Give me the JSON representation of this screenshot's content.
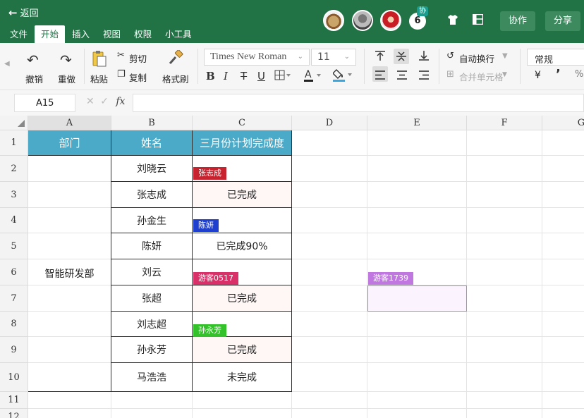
{
  "header": {
    "back_label": "返回",
    "collab_badge": "协",
    "user_count": "6",
    "collab_button": "协作",
    "share_button": "分享"
  },
  "menu": {
    "items": [
      "文件",
      "开始",
      "插入",
      "视图",
      "权限",
      "小工具"
    ],
    "active": "开始"
  },
  "ribbon": {
    "undo": "撤销",
    "redo": "重做",
    "paste": "粘贴",
    "cut": "剪切",
    "copy": "复制",
    "format_painter": "格式刷",
    "font_name": "Times New Roman",
    "font_size": "11",
    "wrap_text": "自动换行",
    "merge_cells": "合并单元格",
    "number_format": "常规",
    "currency_symbol": "¥"
  },
  "formula_bar": {
    "cell_ref": "A15",
    "fx": "fx",
    "value": ""
  },
  "columns": [
    "A",
    "B",
    "C",
    "D",
    "E",
    "F",
    "G"
  ],
  "rows": [
    "1",
    "2",
    "3",
    "4",
    "5",
    "6",
    "7",
    "8",
    "9",
    "10",
    "11",
    "12"
  ],
  "table": {
    "headers": [
      "部门",
      "姓名",
      "三月份计划完成度"
    ],
    "department": "智能研发部",
    "names": [
      "刘晓云",
      "张志成",
      "孙金生",
      "陈妍",
      "刘云",
      "张超",
      "刘志超",
      "孙永芳",
      "马浩浩"
    ],
    "progress": [
      "",
      "已完成",
      "",
      "已完成90%",
      "",
      "已完成",
      "",
      "已完成",
      "未完成"
    ]
  },
  "collaborators": [
    {
      "name": "张志成",
      "color": "#c8222f"
    },
    {
      "name": "陈妍",
      "color": "#1f3fcf"
    },
    {
      "name": "游客0517",
      "color": "#d9306a"
    },
    {
      "name": "孙永芳",
      "color": "#34c22a"
    },
    {
      "name": "游客1739",
      "color": "#c078e0"
    }
  ]
}
